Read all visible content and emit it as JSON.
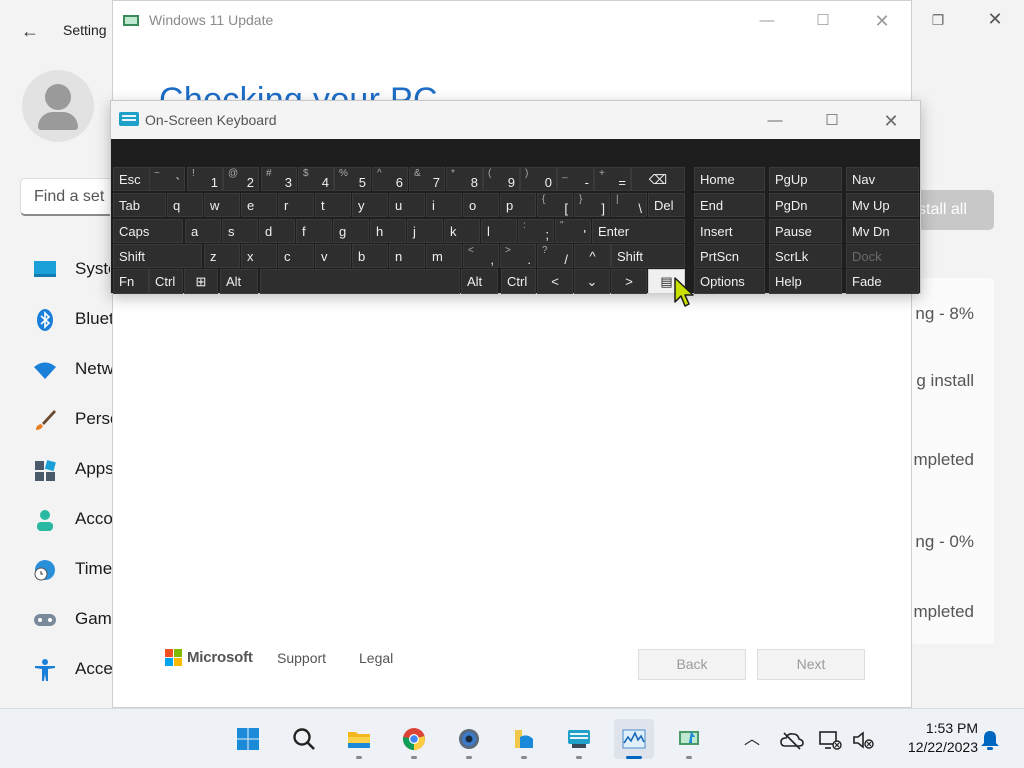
{
  "settings": {
    "title": "Setting",
    "search_placeholder": "Find a set",
    "install_all_label": "stall all",
    "nav": [
      {
        "label": "Syste",
        "icon": "monitor-icon"
      },
      {
        "label": "Bluet",
        "icon": "bluetooth-icon"
      },
      {
        "label": "Netw",
        "icon": "wifi-icon"
      },
      {
        "label": "Perso",
        "icon": "paintbrush-icon"
      },
      {
        "label": "Apps",
        "icon": "apps-icon"
      },
      {
        "label": "Acco",
        "icon": "account-icon"
      },
      {
        "label": "Time",
        "icon": "globe-clock-icon"
      },
      {
        "label": "Gam",
        "icon": "gamepad-icon"
      },
      {
        "label": "Acce",
        "icon": "accessibility-icon"
      }
    ],
    "updates_status": [
      "ng - 8%",
      "g install",
      "mpleted",
      "ng - 0%",
      "mpleted"
    ]
  },
  "update_window": {
    "title": "Windows 11 Update",
    "heading": "Checking your PC",
    "brand": "Microsoft",
    "links": [
      "Support",
      "Legal"
    ],
    "back_label": "Back",
    "next_label": "Next"
  },
  "osk": {
    "title": "On-Screen Keyboard",
    "rows": {
      "r1": [
        {
          "main": "Esc"
        },
        {
          "sh": "~",
          "lo": "`"
        },
        {
          "sh": "!",
          "lo": "1"
        },
        {
          "sh": "@",
          "lo": "2"
        },
        {
          "sh": "#",
          "lo": "3"
        },
        {
          "sh": "$",
          "lo": "4"
        },
        {
          "sh": "%",
          "lo": "5"
        },
        {
          "sh": "^",
          "lo": "6"
        },
        {
          "sh": "&",
          "lo": "7"
        },
        {
          "sh": "*",
          "lo": "8"
        },
        {
          "sh": "(",
          "lo": "9"
        },
        {
          "sh": ")",
          "lo": "0"
        },
        {
          "sh": "_",
          "lo": "-"
        },
        {
          "sh": "+",
          "lo": "="
        },
        {
          "main": "⌫"
        }
      ],
      "r2": [
        {
          "main": "Tab"
        },
        {
          "main": "q"
        },
        {
          "main": "w"
        },
        {
          "main": "e"
        },
        {
          "main": "r"
        },
        {
          "main": "t"
        },
        {
          "main": "y"
        },
        {
          "main": "u"
        },
        {
          "main": "i"
        },
        {
          "main": "o"
        },
        {
          "main": "p"
        },
        {
          "sh": "{",
          "lo": "["
        },
        {
          "sh": "}",
          "lo": "]"
        },
        {
          "sh": "|",
          "lo": "\\"
        },
        {
          "main": "Del"
        }
      ],
      "r3": [
        {
          "main": "Caps"
        },
        {
          "main": "a"
        },
        {
          "main": "s"
        },
        {
          "main": "d"
        },
        {
          "main": "f"
        },
        {
          "main": "g"
        },
        {
          "main": "h"
        },
        {
          "main": "j"
        },
        {
          "main": "k"
        },
        {
          "main": "l"
        },
        {
          "sh": ":",
          "lo": ";"
        },
        {
          "sh": "\"",
          "lo": "'"
        },
        {
          "main": "Enter"
        }
      ],
      "r4": [
        {
          "main": "Shift"
        },
        {
          "main": "z"
        },
        {
          "main": "x"
        },
        {
          "main": "c"
        },
        {
          "main": "v"
        },
        {
          "main": "b"
        },
        {
          "main": "n"
        },
        {
          "main": "m"
        },
        {
          "sh": "<",
          "lo": ","
        },
        {
          "sh": ">",
          "lo": "."
        },
        {
          "sh": "?",
          "lo": "/"
        },
        {
          "main": "^"
        },
        {
          "main": "Shift"
        }
      ],
      "r5": [
        {
          "main": "Fn"
        },
        {
          "main": "Ctrl"
        },
        {
          "main": "⊞"
        },
        {
          "main": "Alt"
        },
        {
          "main": ""
        },
        {
          "main": "Alt"
        },
        {
          "main": "Ctrl"
        },
        {
          "main": "<"
        },
        {
          "main": "⌄"
        },
        {
          "main": ">"
        },
        {
          "main": "▤"
        }
      ]
    },
    "side": [
      [
        "Home",
        "PgUp",
        "Nav"
      ],
      [
        "End",
        "PgDn",
        "Mv Up"
      ],
      [
        "Insert",
        "Pause",
        "Mv Dn"
      ],
      [
        "PrtScn",
        "ScrLk",
        "Dock"
      ],
      [
        "Options",
        "Help",
        "Fade"
      ]
    ]
  },
  "taskbar": {
    "apps": [
      "start-icon",
      "search-icon",
      "file-explorer-icon",
      "chrome-icon",
      "settings-icon",
      "files-icon",
      "osk-icon",
      "task-manager-icon",
      "windows-update-icon"
    ],
    "time": "1:53 PM",
    "date": "12/22/2023"
  }
}
